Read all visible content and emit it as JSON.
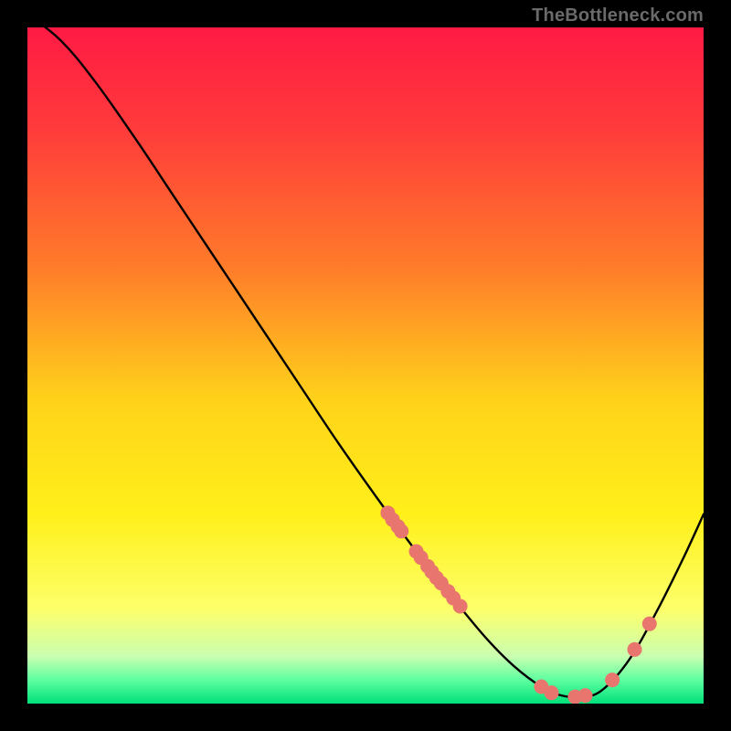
{
  "watermark": "TheBottleneck.com",
  "chart_data": {
    "type": "line",
    "title": "",
    "xlabel": "",
    "ylabel": "",
    "xlim": [
      0,
      1
    ],
    "ylim": [
      0,
      1
    ],
    "background_gradient": {
      "stops": [
        {
          "offset": 0.0,
          "color": "#ff1a44"
        },
        {
          "offset": 0.15,
          "color": "#ff3b3b"
        },
        {
          "offset": 0.35,
          "color": "#ff7a2a"
        },
        {
          "offset": 0.55,
          "color": "#ffd21a"
        },
        {
          "offset": 0.72,
          "color": "#fff01a"
        },
        {
          "offset": 0.86,
          "color": "#fdff6a"
        },
        {
          "offset": 0.93,
          "color": "#c9ffb0"
        },
        {
          "offset": 0.965,
          "color": "#5effa0"
        },
        {
          "offset": 1.0,
          "color": "#00e07a"
        }
      ]
    },
    "curve": [
      {
        "x": 0.0,
        "y": 1.02
      },
      {
        "x": 0.05,
        "y": 0.98
      },
      {
        "x": 0.1,
        "y": 0.92
      },
      {
        "x": 0.16,
        "y": 0.835
      },
      {
        "x": 0.22,
        "y": 0.745
      },
      {
        "x": 0.28,
        "y": 0.655
      },
      {
        "x": 0.34,
        "y": 0.565
      },
      {
        "x": 0.4,
        "y": 0.475
      },
      {
        "x": 0.46,
        "y": 0.385
      },
      {
        "x": 0.52,
        "y": 0.3
      },
      {
        "x": 0.575,
        "y": 0.225
      },
      {
        "x": 0.63,
        "y": 0.155
      },
      {
        "x": 0.68,
        "y": 0.095
      },
      {
        "x": 0.72,
        "y": 0.055
      },
      {
        "x": 0.76,
        "y": 0.025
      },
      {
        "x": 0.79,
        "y": 0.012
      },
      {
        "x": 0.82,
        "y": 0.01
      },
      {
        "x": 0.85,
        "y": 0.02
      },
      {
        "x": 0.89,
        "y": 0.065
      },
      {
        "x": 0.93,
        "y": 0.135
      },
      {
        "x": 0.97,
        "y": 0.215
      },
      {
        "x": 1.0,
        "y": 0.28
      }
    ],
    "points": {
      "color": "#e9766e",
      "radius": 8,
      "data": [
        {
          "x": 0.533,
          "y": 0.282
        },
        {
          "x": 0.54,
          "y": 0.272
        },
        {
          "x": 0.548,
          "y": 0.262
        },
        {
          "x": 0.553,
          "y": 0.255
        },
        {
          "x": 0.575,
          "y": 0.225
        },
        {
          "x": 0.582,
          "y": 0.216
        },
        {
          "x": 0.592,
          "y": 0.203
        },
        {
          "x": 0.598,
          "y": 0.195
        },
        {
          "x": 0.605,
          "y": 0.186
        },
        {
          "x": 0.612,
          "y": 0.178
        },
        {
          "x": 0.622,
          "y": 0.166
        },
        {
          "x": 0.63,
          "y": 0.156
        },
        {
          "x": 0.64,
          "y": 0.144
        },
        {
          "x": 0.76,
          "y": 0.025
        },
        {
          "x": 0.775,
          "y": 0.016
        },
        {
          "x": 0.81,
          "y": 0.01
        },
        {
          "x": 0.825,
          "y": 0.012
        },
        {
          "x": 0.865,
          "y": 0.035
        },
        {
          "x": 0.898,
          "y": 0.08
        },
        {
          "x": 0.92,
          "y": 0.118
        }
      ]
    }
  }
}
